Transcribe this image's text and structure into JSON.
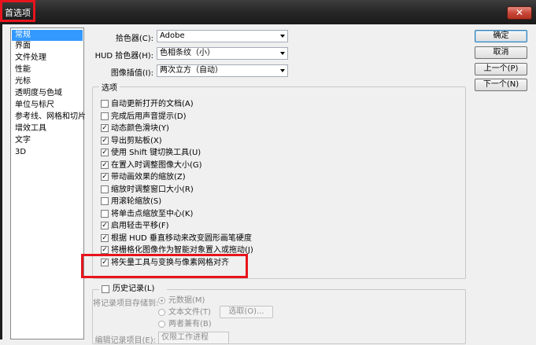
{
  "window": {
    "title": "首选项",
    "close_glyph": "✕"
  },
  "sidebar": {
    "items": [
      {
        "label": "常规",
        "selected": true
      },
      {
        "label": "界面"
      },
      {
        "label": "文件处理"
      },
      {
        "label": "性能"
      },
      {
        "label": "光标"
      },
      {
        "label": "透明度与色域"
      },
      {
        "label": "单位与标尺"
      },
      {
        "label": "参考线、网格和切片"
      },
      {
        "label": "增效工具"
      },
      {
        "label": "文字"
      },
      {
        "label": "3D"
      }
    ]
  },
  "general": {
    "color_picker": {
      "label": "拾色器(C):",
      "value": "Adobe"
    },
    "hud_picker": {
      "label": "HUD 拾色器(H):",
      "value": "色相条纹（小）"
    },
    "interpolation": {
      "label": "图像插值(I):",
      "value": "两次立方（自动）"
    }
  },
  "options": {
    "legend": "选项",
    "items": [
      {
        "label": "自动更新打开的文档(A)",
        "checked": false
      },
      {
        "label": "完成后用声音提示(D)",
        "checked": false
      },
      {
        "label": "动态颜色滑块(Y)",
        "checked": true
      },
      {
        "label": "导出剪贴板(X)",
        "checked": true
      },
      {
        "label": "使用 Shift 键切换工具(U)",
        "checked": true
      },
      {
        "label": "在置入时调整图像大小(G)",
        "checked": true
      },
      {
        "label": "带动画效果的缩放(Z)",
        "checked": true
      },
      {
        "label": "缩放时调整窗口大小(R)",
        "checked": false
      },
      {
        "label": "用滚轮缩放(S)",
        "checked": false
      },
      {
        "label": "将单击点缩放至中心(K)",
        "checked": false
      },
      {
        "label": "启用轻击平移(F)",
        "checked": true
      },
      {
        "label": "根据 HUD 垂直移动来改变圆形画笔硬度",
        "checked": true
      },
      {
        "label": "将栅格化图像作为智能对象置入或拖动(J)",
        "checked": true
      },
      {
        "label": "将矢量工具与变换与像素网格对齐",
        "checked": true
      }
    ]
  },
  "history": {
    "legend": "历史记录(L)",
    "checked": false,
    "save_to_label": "将记录项目存储到:",
    "radios": [
      {
        "label": "元数据(M)",
        "selected": true
      },
      {
        "label": "文本文件(T)",
        "selected": false
      },
      {
        "label": "两者兼有(B)",
        "selected": false
      }
    ],
    "choose_button": "选取(O)...",
    "edit_log_label": "编辑记录项目(E):",
    "edit_log_value": "仅限工作进程"
  },
  "buttons": {
    "ok": "确定",
    "cancel": "取消",
    "prev": "上一个(P)",
    "next": "下一个(N)"
  },
  "check_glyph": "✓",
  "colors": {
    "highlight_red": "#e8141c",
    "selection_blue": "#3399ff",
    "titlebar_dark": "#262626"
  }
}
